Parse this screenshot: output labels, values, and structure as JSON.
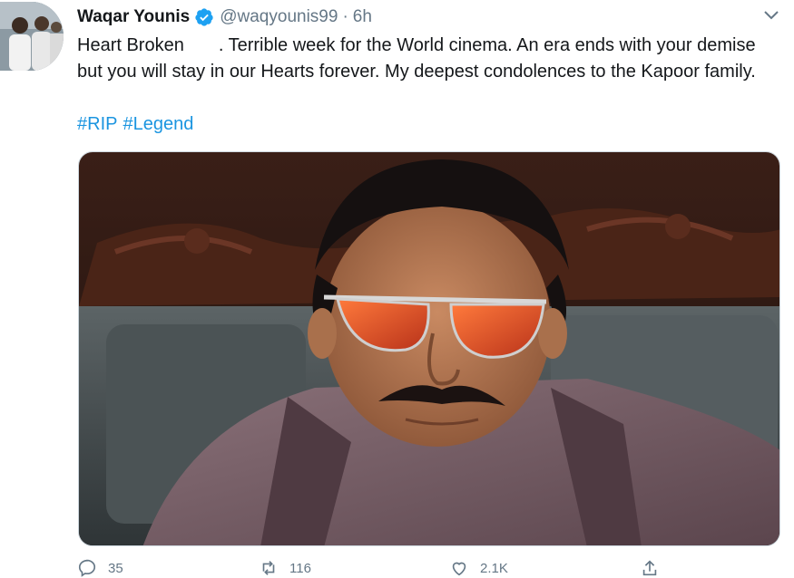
{
  "tweet": {
    "author_name": "Waqar Younis",
    "handle": "@waqyounis99",
    "separator": "·",
    "time": "6h",
    "text_part1": "Heart Broken",
    "text_part2": ". Terrible week for the World cinema. An era ends with your demise but you will stay in our Hearts forever. My deepest condolences to the Kapoor family.",
    "hashtags": [
      "#RIP",
      "#Legend"
    ]
  },
  "actions": {
    "reply_count": "35",
    "retweet_count": "116",
    "like_count": "2.1K"
  },
  "colors": {
    "link": "#1b95e0",
    "verified": "#1da1f2",
    "muted": "#657786"
  }
}
